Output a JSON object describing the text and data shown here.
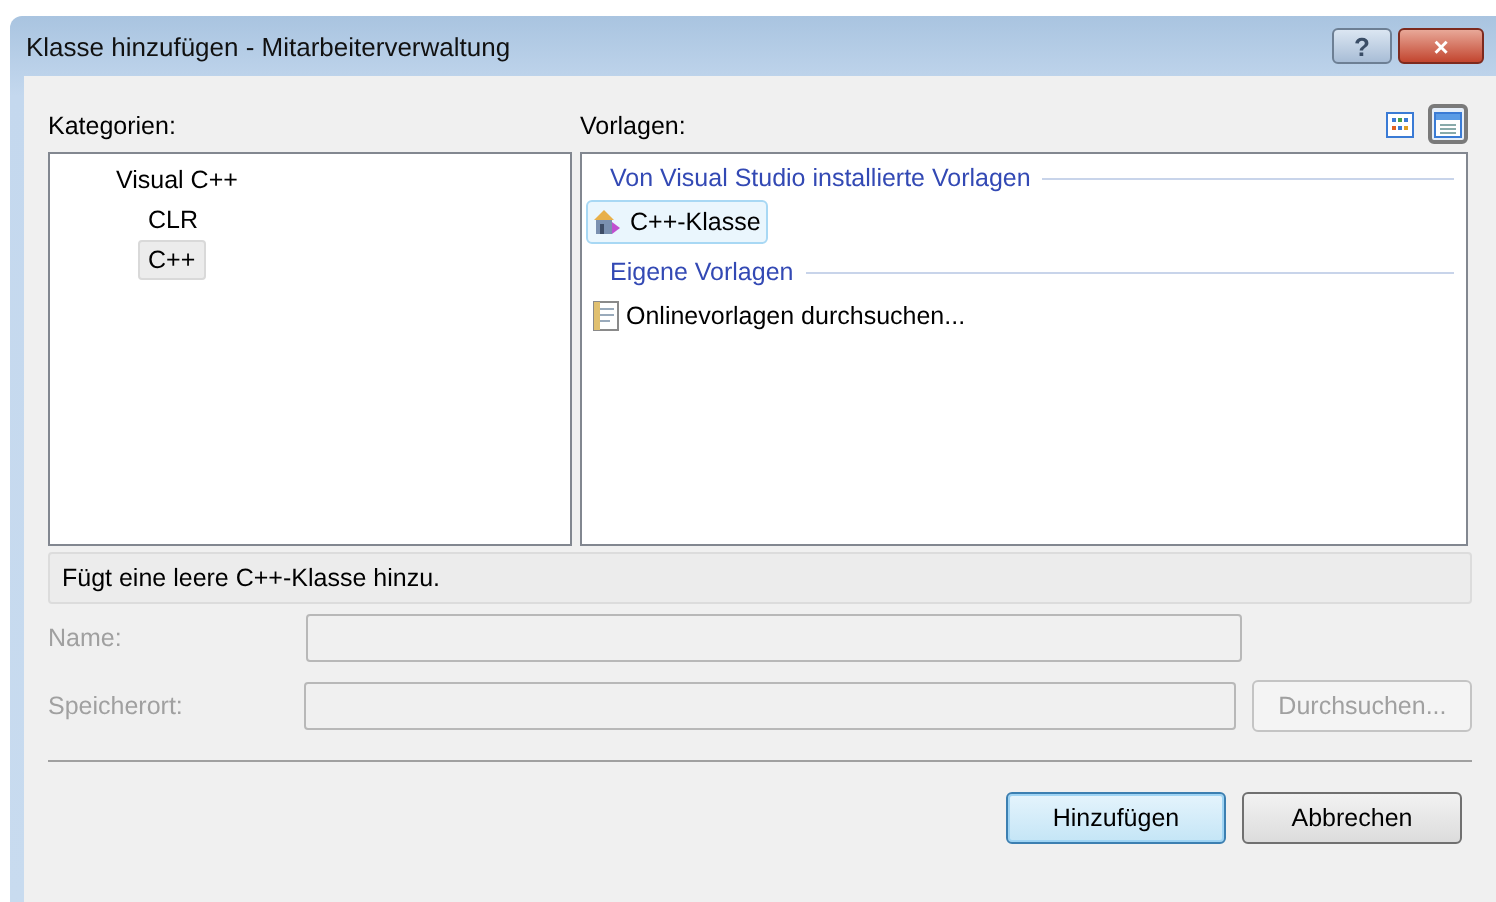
{
  "window": {
    "title": "Klasse hinzufügen - Mitarbeiterverwaltung",
    "help_button": "?",
    "close_button": "×"
  },
  "categories": {
    "label": "Kategorien:",
    "items": [
      {
        "label": "Visual C++",
        "selected": false,
        "children": [
          {
            "label": "CLR",
            "selected": false
          },
          {
            "label": "C++",
            "selected": true
          }
        ]
      }
    ]
  },
  "templates": {
    "label": "Vorlagen:",
    "view_modes": [
      {
        "kind": "grid",
        "selected": false
      },
      {
        "kind": "list",
        "selected": true
      }
    ],
    "groups": [
      {
        "title": "Von Visual Studio installierte Vorlagen",
        "items": [
          {
            "label": "C++-Klasse",
            "kind": "class",
            "selected": true
          }
        ]
      },
      {
        "title": "Eigene Vorlagen",
        "items": [
          {
            "label": "Onlinevorlagen durchsuchen...",
            "kind": "online",
            "selected": false
          }
        ]
      }
    ]
  },
  "description": "Fügt eine leere C++-Klasse hinzu.",
  "fields": [
    {
      "label": "Name:",
      "disabled": true
    },
    {
      "label": "Speicherort:",
      "disabled": true,
      "button": "Durchsuchen..."
    }
  ],
  "buttons": [
    {
      "label": "Hinzufügen",
      "default": true
    },
    {
      "label": "Abbrechen",
      "default": false
    }
  ]
}
